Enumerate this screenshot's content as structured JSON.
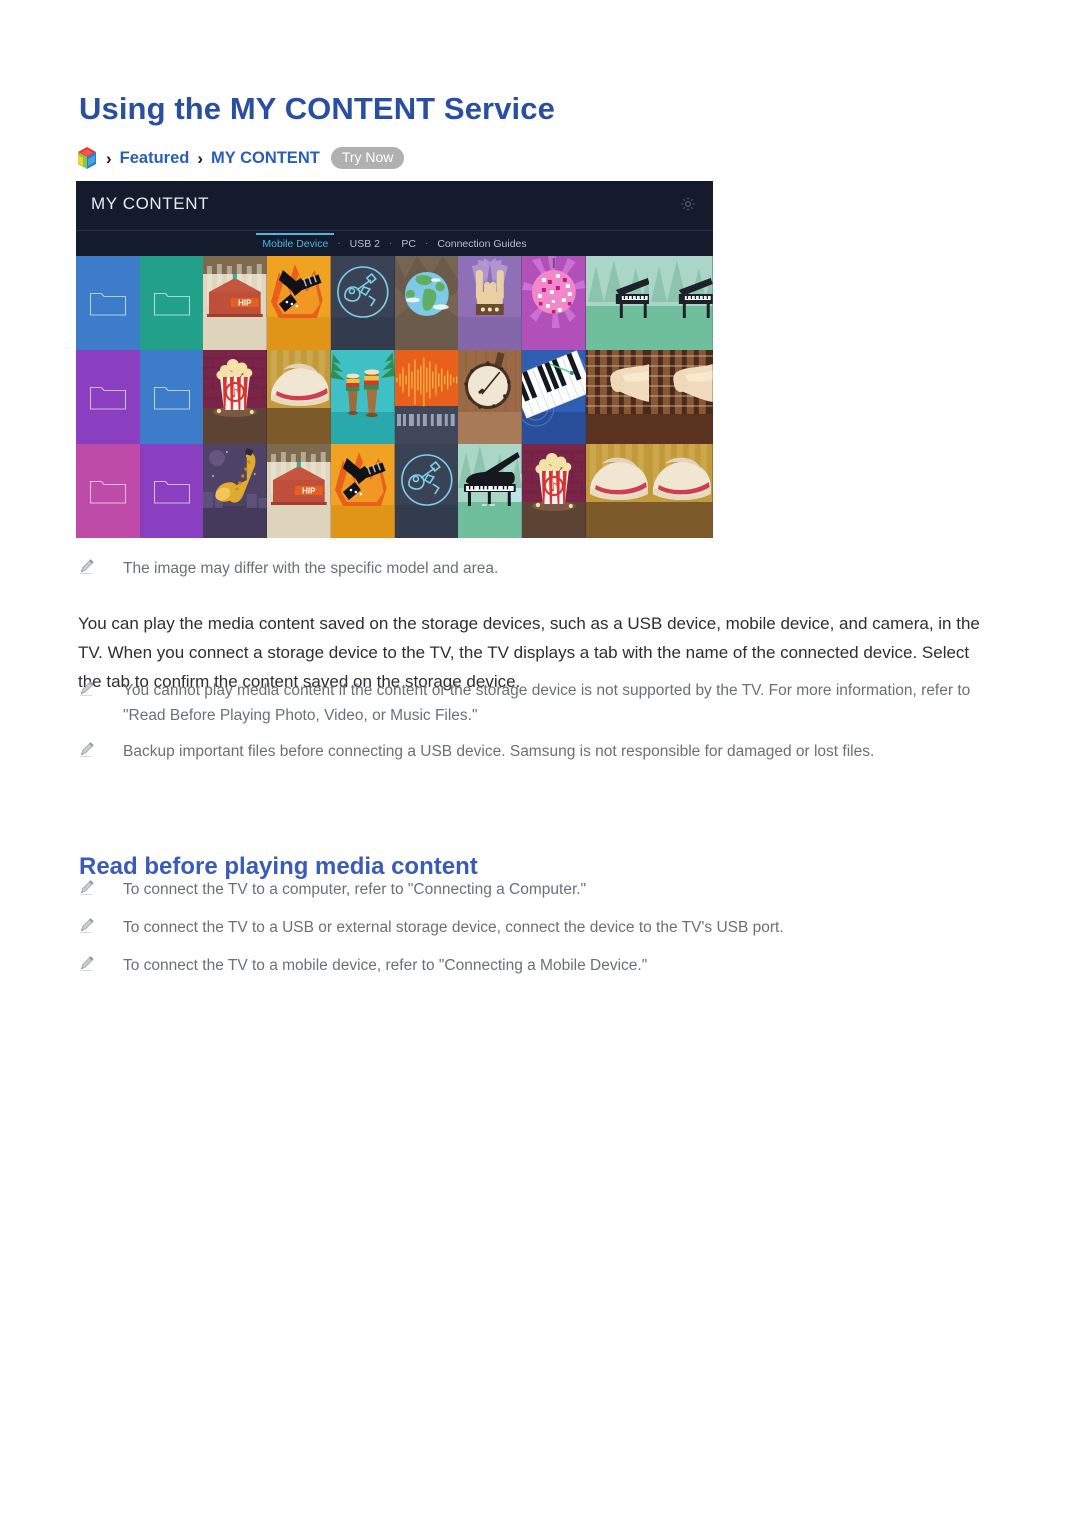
{
  "page": {
    "title": "Using the MY CONTENT Service"
  },
  "breadcrumb": {
    "home_icon": "smart-hub-cube-icon",
    "sep": "›",
    "items": [
      "Featured",
      "MY CONTENT"
    ],
    "try_now_label": "Try Now"
  },
  "tv_screenshot": {
    "header_title": "MY CONTENT",
    "gear_icon": "gear-icon",
    "tabs": [
      {
        "label": "Mobile Device",
        "active": true
      },
      {
        "label": "USB 2",
        "active": false
      },
      {
        "label": "PC",
        "active": false
      },
      {
        "label": "Connection Guides",
        "active": false
      }
    ],
    "tab_separator": "·",
    "grid": {
      "columns": 10,
      "rows": 3,
      "tiles": [
        {
          "kind": "folder",
          "color": "#3d7cc9",
          "name": "folder-tile"
        },
        {
          "kind": "folder",
          "color": "#21a08a",
          "name": "folder-tile"
        },
        {
          "kind": "art",
          "art": "hip-building",
          "name": "thumbnail-hip-building"
        },
        {
          "kind": "art",
          "art": "guitar-fire",
          "name": "thumbnail-flying-v-guitar"
        },
        {
          "kind": "art",
          "art": "guitar-neon",
          "name": "thumbnail-guitar-outline"
        },
        {
          "kind": "art",
          "art": "globe",
          "name": "thumbnail-globe"
        },
        {
          "kind": "art",
          "art": "rock-hand",
          "name": "thumbnail-rock-hand"
        },
        {
          "kind": "art",
          "art": "disco-ball",
          "name": "thumbnail-disco-ball"
        },
        {
          "kind": "art",
          "art": "piano-forest",
          "name": "thumbnail-piano-forest"
        },
        {
          "kind": "art",
          "art": "piano-forest",
          "name": "thumbnail-piano-forest"
        },
        {
          "kind": "folder",
          "color": "#8a3fc0",
          "name": "folder-tile"
        },
        {
          "kind": "folder",
          "color": "#3d7cc9",
          "name": "folder-tile"
        },
        {
          "kind": "art",
          "art": "popcorn",
          "name": "thumbnail-popcorn"
        },
        {
          "kind": "art",
          "art": "cowboy-hat",
          "name": "thumbnail-cowboy-hat"
        },
        {
          "kind": "art",
          "art": "bongos",
          "name": "thumbnail-bongo-drums"
        },
        {
          "kind": "art",
          "art": "waveform",
          "name": "thumbnail-audio-waveform"
        },
        {
          "kind": "art",
          "art": "banjo",
          "name": "thumbnail-banjo"
        },
        {
          "kind": "art",
          "art": "piano-keys",
          "name": "thumbnail-piano-keys"
        },
        {
          "kind": "art",
          "art": "fretboard",
          "name": "thumbnail-guitar-fretboard"
        },
        {
          "kind": "art",
          "art": "fretboard",
          "name": "thumbnail-guitar-fretboard"
        },
        {
          "kind": "folder",
          "color": "#bf4ba8",
          "name": "folder-tile"
        },
        {
          "kind": "folder",
          "color": "#8a3fc0",
          "name": "folder-tile"
        },
        {
          "kind": "art",
          "art": "saxophone",
          "name": "thumbnail-saxophone"
        },
        {
          "kind": "art",
          "art": "hip-building",
          "name": "thumbnail-hip-building"
        },
        {
          "kind": "art",
          "art": "guitar-fire",
          "name": "thumbnail-flying-v-guitar"
        },
        {
          "kind": "art",
          "art": "guitar-neon",
          "name": "thumbnail-guitar-outline"
        },
        {
          "kind": "art",
          "art": "grand-piano",
          "name": "thumbnail-grand-piano"
        },
        {
          "kind": "art",
          "art": "popcorn",
          "name": "thumbnail-popcorn"
        },
        {
          "kind": "art",
          "art": "cowboy-hat",
          "name": "thumbnail-cowboy-hat"
        },
        {
          "kind": "art",
          "art": "cowboy-hat",
          "name": "thumbnail-cowboy-hat"
        }
      ]
    }
  },
  "image_note": "The image may differ with the specific model and area.",
  "body_paragraph": "You can play the media content saved on the storage devices, such as a USB device, mobile device, and camera, in the TV. When you connect a storage device to the TV, the TV displays a tab with the name of the connected device. Select the tab to confirm the content saved on the storage device.",
  "notes": [
    "You cannot play media content if the content or the storage device is not supported by the TV. For more information, refer to \"Read Before Playing Photo, Video, or Music Files.\"",
    "Backup important files before connecting a USB device. Samsung is not responsible for damaged or lost files."
  ],
  "section": {
    "title": "Read before playing media content",
    "notes": [
      "To connect the TV to a computer, refer to \"Connecting a Computer.\"",
      "To connect the TV to a USB or external storage device, connect the device to the TV's USB port.",
      "To connect the TV to a mobile device, refer to \"Connecting a Mobile Device.\""
    ]
  },
  "colors": {
    "title_blue": "#2a4fa0",
    "section_blue": "#3a5bb8",
    "link_blue": "#2a5fb8",
    "note_gray": "#6b6f78",
    "tv_bg": "#141b2d",
    "tab_active": "#4fb6e0",
    "try_now_bg": "#b0b0b0"
  }
}
